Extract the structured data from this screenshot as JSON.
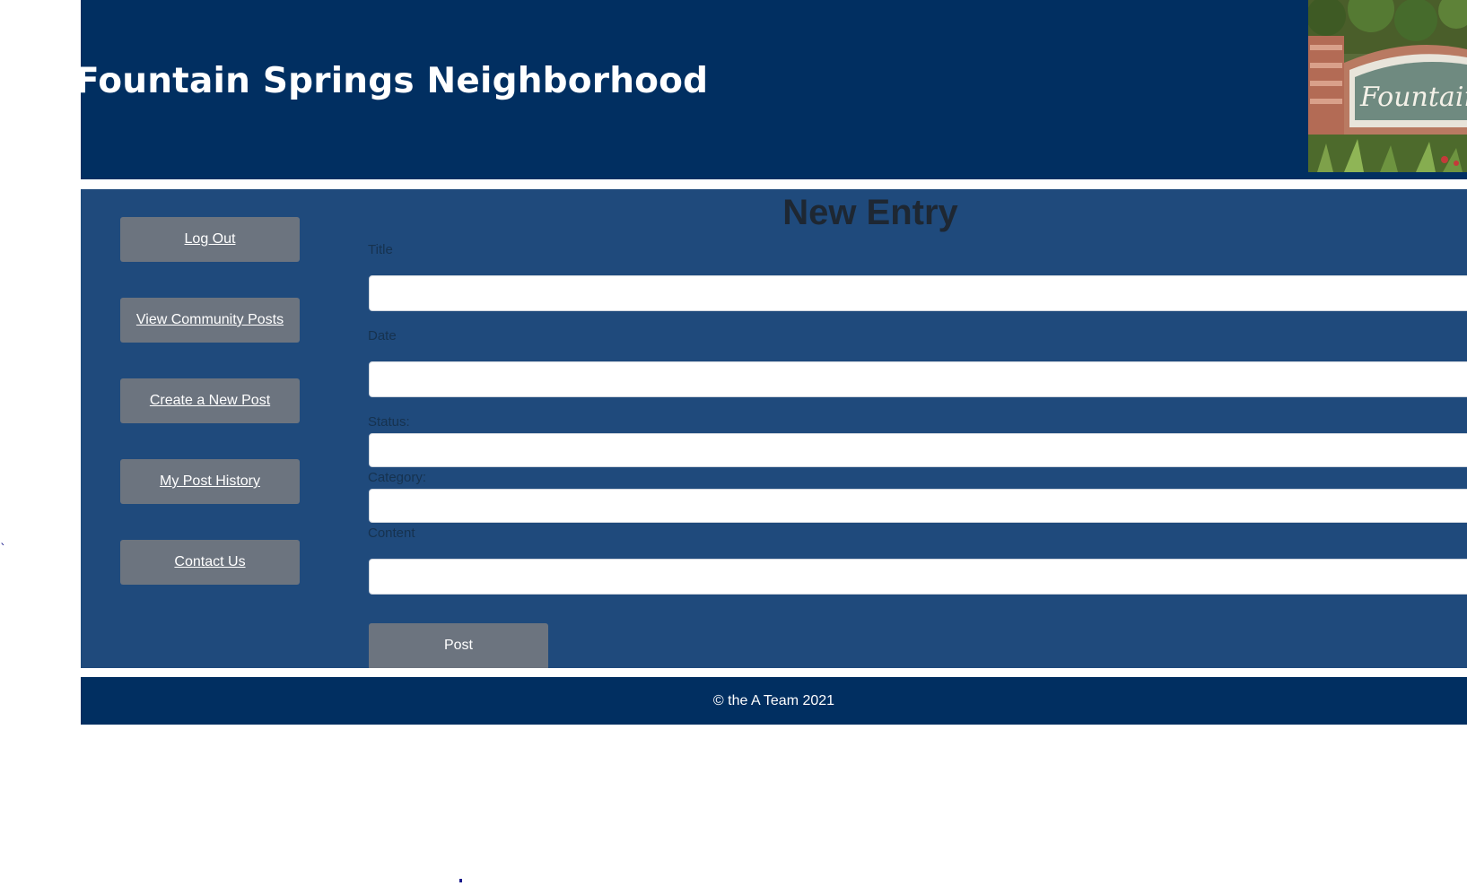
{
  "header": {
    "title": "Fountain Springs Neighborhood",
    "photo_sign_text": "Fountain S"
  },
  "sidebar": {
    "items": [
      {
        "label": "Log Out"
      },
      {
        "label": "View Community Posts"
      },
      {
        "label": "Create a New Post"
      },
      {
        "label": "My Post History"
      },
      {
        "label": "Contact Us"
      }
    ]
  },
  "form": {
    "heading": "New Entry",
    "fields": [
      {
        "label": "Title",
        "value": ""
      },
      {
        "label": "Date",
        "value": ""
      },
      {
        "label": "Status:",
        "value": ""
      },
      {
        "label": "Category:",
        "value": ""
      },
      {
        "label": "Content",
        "value": ""
      }
    ],
    "submit_label": "Post"
  },
  "footer": {
    "text": "© the A Team 2021"
  },
  "colors": {
    "header_bg": "#012f61",
    "main_bg": "#1f4a7c",
    "button_bg": "#6c747f",
    "footer_bg": "#012f61"
  }
}
